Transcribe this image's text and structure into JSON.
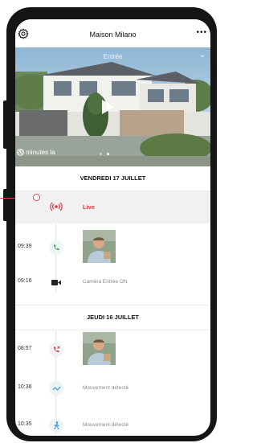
{
  "header": {
    "title": "Maison Milano",
    "settings_icon": "gear-icon",
    "more_label": "•••"
  },
  "camera": {
    "name": "Entrée",
    "last_seen": "23 minutes la",
    "page_count": 2,
    "active_page": 1
  },
  "days": [
    {
      "label": "VENDREDI 17 JUILLET"
    },
    {
      "label": "JEUDI 16 JUILLET"
    }
  ],
  "events": [
    {
      "time": "",
      "icon": "live-signal-icon",
      "label": "Live",
      "color": "#d63b3b"
    },
    {
      "time": "09:39",
      "icon": "phone-answered-icon",
      "label": "",
      "color": "#3aa35c"
    },
    {
      "time": "09:16",
      "icon": "video-camera-icon",
      "label": "Caméra Entrée ON",
      "color": "#222222"
    },
    {
      "time": "08:57",
      "icon": "missed-call-icon",
      "label": "",
      "color": "#d63b3b"
    },
    {
      "time": "10:36",
      "icon": "motion-icon",
      "label": "Mouvement détecté",
      "color": "#3a9bd6"
    },
    {
      "time": "10:35",
      "icon": "person-walking-icon",
      "label": "Mouvement détecté",
      "color": "#3a9bd6"
    }
  ],
  "colors": {
    "accent": "#d63b3b",
    "frame": "#151515"
  }
}
